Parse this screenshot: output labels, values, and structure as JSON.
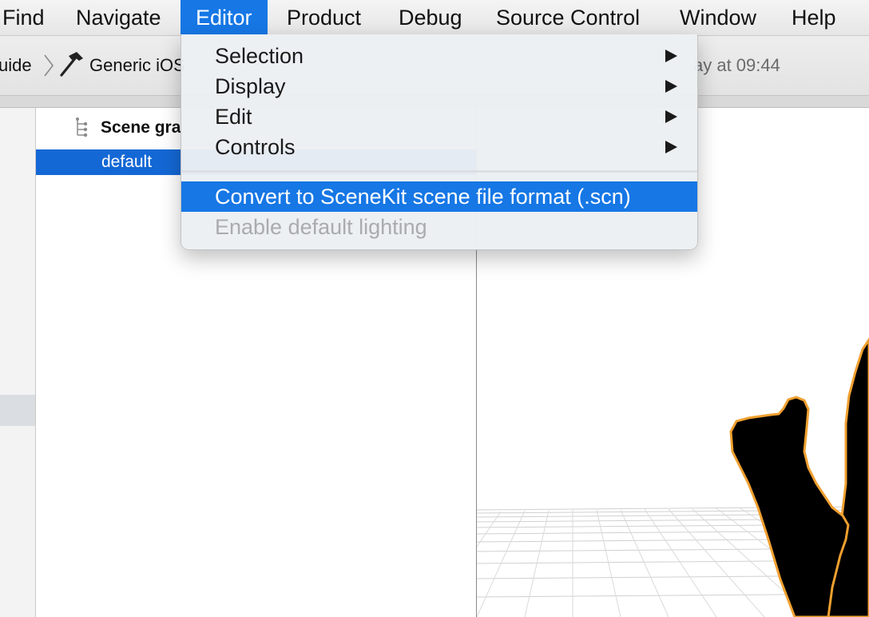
{
  "menubar": {
    "items": [
      {
        "label": "Find"
      },
      {
        "label": "Navigate"
      },
      {
        "label": "Editor"
      },
      {
        "label": "Product"
      },
      {
        "label": "Debug"
      },
      {
        "label": "Source Control"
      },
      {
        "label": "Window"
      },
      {
        "label": "Help"
      }
    ],
    "active_label": "Editor"
  },
  "toolbar": {
    "scheme_target": "uide",
    "scheme_device": "Generic iOS",
    "status_text": "ay at 09:44",
    "icons": [
      "chevron-right-icon",
      "hammer-icon"
    ]
  },
  "outline": {
    "title": "Scene gra",
    "selected_item": "default",
    "icon": "scene-graph-icon"
  },
  "editor_menu": {
    "submenus": [
      {
        "label": "Selection"
      },
      {
        "label": "Display"
      },
      {
        "label": "Edit"
      },
      {
        "label": "Controls"
      }
    ],
    "actions": [
      {
        "label": "Convert to SceneKit scene file format (.scn)",
        "state": "highlighted"
      },
      {
        "label": "Enable default lighting",
        "state": "disabled"
      }
    ]
  },
  "colors": {
    "accent": "#1677e5",
    "selection": "#1468d5",
    "disabled_text": "#a9abae",
    "model_outline": "#f0a030"
  }
}
